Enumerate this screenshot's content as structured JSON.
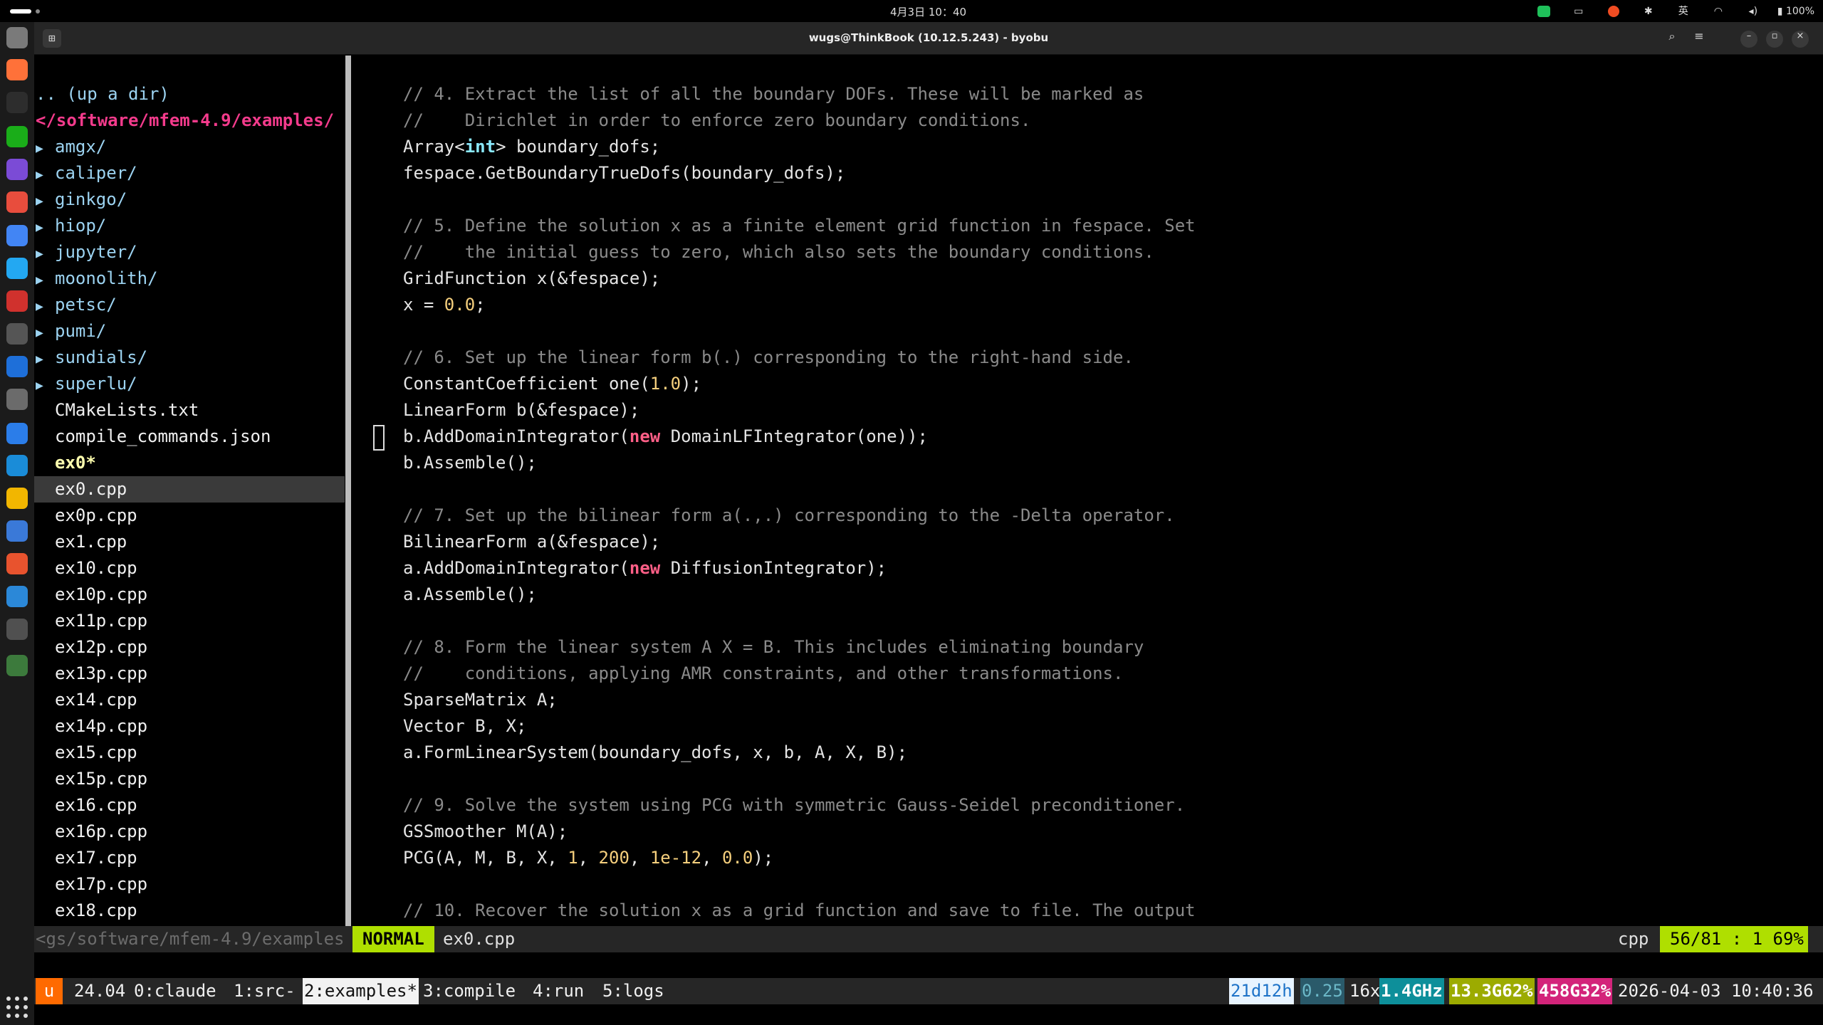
{
  "topbar": {
    "clock": "4月3日 10：40",
    "input_method": "英",
    "battery": "100%",
    "icons": [
      "wechat-tray-icon",
      "screen-tray-icon",
      "record-tray-icon",
      "accessibility-icon",
      "input-method-icon",
      "wifi-icon",
      "volume-icon",
      "battery-icon"
    ]
  },
  "window": {
    "title": "wugs@ThinkBook (10.12.5.243) - byobu",
    "new_tab_glyph": "⊞",
    "search_glyph": "⌕",
    "menu_glyph": "≡",
    "minimize_glyph": "–",
    "maximize_glyph": "▫",
    "close_glyph": "×"
  },
  "tree": {
    "up": ".. (up a dir)",
    "path": "</software/mfem-4.9/examples/",
    "arrow": "▶",
    "dirs": [
      "amgx/",
      "caliper/",
      "ginkgo/",
      "hiop/",
      "jupyter/",
      "moonolith/",
      "petsc/",
      "pumi/",
      "sundials/",
      "superlu/"
    ],
    "files": [
      "CMakeLists.txt",
      "compile_commands.json"
    ],
    "exe": "ex0*",
    "selected": "ex0.cpp",
    "rest": [
      "ex0p.cpp",
      "ex1.cpp",
      "ex10.cpp",
      "ex10p.cpp",
      "ex11p.cpp",
      "ex12p.cpp",
      "ex13p.cpp",
      "ex14.cpp",
      "ex14p.cpp",
      "ex15.cpp",
      "ex15p.cpp",
      "ex16.cpp",
      "ex16p.cpp",
      "ex17.cpp",
      "ex17p.cpp",
      "ex18.cpp"
    ]
  },
  "code": {
    "l1": "// 4. Extract the list of all the boundary DOFs. These will be marked as",
    "l2": "//    Dirichlet in order to enforce zero boundary conditions.",
    "l3a": "Array<",
    "l3b": "int",
    "l3c": "> boundary_dofs;",
    "l4": "fespace.GetBoundaryTrueDofs(boundary_dofs);",
    "l6": "// 5. Define the solution x as a finite element grid function in fespace. Set",
    "l7": "//    the initial guess to zero, which also sets the boundary conditions.",
    "l8": "GridFunction x(&fespace);",
    "l9a": "x = ",
    "l9b": "0.0",
    "l9c": ";",
    "l11": "// 6. Set up the linear form b(.) corresponding to the right-hand side.",
    "l12a": "ConstantCoefficient one(",
    "l12b": "1.0",
    "l12c": ");",
    "l13": "LinearForm b(&fespace);",
    "l14a": "b.AddDomainIntegrator(",
    "l14b": "new",
    "l14c": " DomainLFIntegrator(one));",
    "l15": "b.Assemble();",
    "l17": "// 7. Set up the bilinear form a(.,.) corresponding to the -Delta operator.",
    "l18": "BilinearForm a(&fespace);",
    "l19a": "a.AddDomainIntegrator(",
    "l19b": "new",
    "l19c": " DiffusionIntegrator);",
    "l20": "a.Assemble();",
    "l22": "// 8. Form the linear system A X = B. This includes eliminating boundary",
    "l23": "//    conditions, applying AMR constraints, and other transformations.",
    "l24": "SparseMatrix A;",
    "l25": "Vector B, X;",
    "l26": "a.FormLinearSystem(boundary_dofs, x, b, A, X, B);",
    "l28": "// 9. Solve the system using PCG with symmetric Gauss-Seidel preconditioner.",
    "l29": "GSSmoother M(A);",
    "l30a": "PCG(A, M, B, X, ",
    "l30b": "1",
    "l30c": ", ",
    "l30d": "200",
    "l30e": ", ",
    "l30f": "1e-12",
    "l30g": ", ",
    "l30h": "0.0",
    "l30i": ");",
    "l32": "// 10. Recover the solution x as a grid function and save to file. The output"
  },
  "status": {
    "left_path": "<gs/software/mfem-4.9/examples",
    "mode": "NORMAL",
    "file": "ex0.cpp",
    "filetype": "cpp",
    "position": "56/81 : 1 69%"
  },
  "byobu": {
    "logo": "u",
    "release": "24.04",
    "win0": "0:claude",
    "win1": "1:src-",
    "win2": "2:examples*",
    "win3": "3:compile",
    "win4": "4:run",
    "win5": "5:logs",
    "uptime": "21d12h",
    "load": "0.25",
    "cpu_count": "16x",
    "cpu_freq": "1.4GHz",
    "mem": "13.3G62%",
    "disk": "458G32%",
    "datetime": "2026-04-03 10:40:36"
  },
  "dock": {
    "apps": [
      "files-icon",
      "firefox-icon",
      "terminal-icon",
      "wechat-icon",
      "app-icon",
      "calendar-icon",
      "chrome-icon",
      "vscode-icon",
      "wps-icon",
      "settings-icon",
      "app-icon-2",
      "keyboard-icon",
      "network-icon",
      "reader-icon",
      "notes-icon",
      "maps-icon",
      "matlab-icon",
      "cloud-icon",
      "media-icon",
      "trash-icon",
      "show-apps-icon"
    ],
    "colors": [
      "#7a7a7a",
      "#ff7139",
      "#2d2d2d",
      "#1aad19",
      "#7b4bd6",
      "#e84d3d",
      "#4285f4",
      "#23a8f2",
      "#d0312d",
      "#555555",
      "#1e6fd9",
      "#6b6b6b",
      "#2b7de9",
      "#1a8cd8",
      "#f2b600",
      "#3a79d8",
      "#e8532e",
      "#2b88d8",
      "#505050",
      "#3c7a3c"
    ]
  }
}
